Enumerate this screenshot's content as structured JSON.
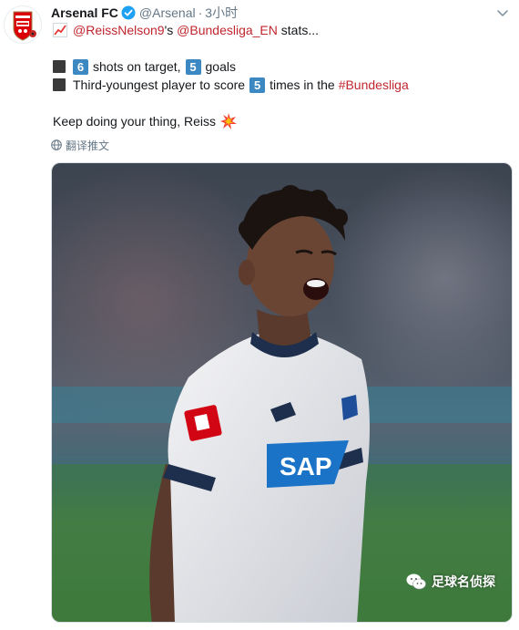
{
  "tweet": {
    "name": "Arsenal FC",
    "handle": "@Arsenal",
    "separator": "·",
    "time": "3小时",
    "line1": {
      "mention1": "@ReissNelson9",
      "text1": "'s ",
      "mention2": "@Bundesliga_EN",
      "text2": " stats..."
    },
    "line2": {
      "num1": "6",
      "text1": "shots on target,",
      "num2": "5",
      "text2": "goals"
    },
    "line3": {
      "text1": "Third-youngest player to score",
      "num": "5",
      "text2": "times in the",
      "hashtag": "#Bundesliga"
    },
    "line4": {
      "text": "Keep doing your thing, Reiss"
    },
    "translate_label": "翻译推文"
  },
  "watermark": {
    "text": "足球名侦探"
  },
  "colors": {
    "accent": "#c0262e",
    "verified": "#1da1f2",
    "muted": "#657786",
    "keycap": "#3b88c3"
  },
  "icons": {
    "verified": "verified-badge-icon",
    "caret": "chevron-down-icon",
    "chart": "chart-increasing-icon",
    "collision": "collision-icon",
    "globe": "globe-icon",
    "wechat": "wechat-icon"
  }
}
